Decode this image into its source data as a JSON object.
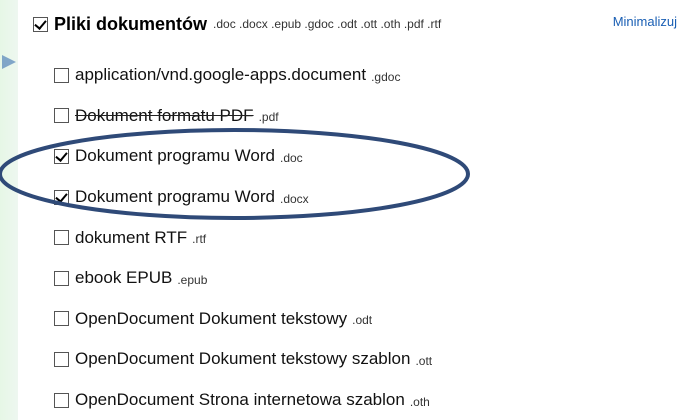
{
  "header": {
    "title": "Pliki dokumentów",
    "extensions": ".doc .docx .epub .gdoc .odt .ott .oth .pdf .rtf",
    "checked": true,
    "minimize_label": "Minimalizuj"
  },
  "items": [
    {
      "label": "application/vnd.google-apps.document",
      "ext": ".gdoc",
      "checked": false
    },
    {
      "label": "Dokument formatu PDF",
      "ext": ".pdf",
      "checked": false
    },
    {
      "label": "Dokument programu Word",
      "ext": ".doc",
      "checked": true
    },
    {
      "label": "Dokument programu Word",
      "ext": ".docx",
      "checked": true
    },
    {
      "label": "dokument RTF",
      "ext": ".rtf",
      "checked": false
    },
    {
      "label": "ebook EPUB",
      "ext": ".epub",
      "checked": false
    },
    {
      "label": "OpenDocument Dokument tekstowy",
      "ext": ".odt",
      "checked": false
    },
    {
      "label": "OpenDocument Dokument tekstowy szablon",
      "ext": ".ott",
      "checked": false
    },
    {
      "label": "OpenDocument Strona internetowa szablon",
      "ext": ".oth",
      "checked": false
    }
  ],
  "colors": {
    "highlight_ellipse": "#2f4a78",
    "link": "#1a5fb4",
    "arrow": "#3a6fb0"
  }
}
